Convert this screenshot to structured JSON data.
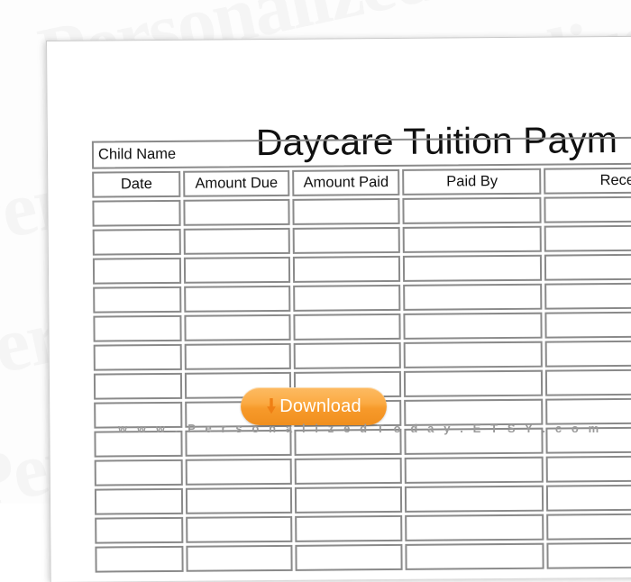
{
  "document": {
    "title": "Daycare Tuition Paym",
    "title_full_visible": "Daycare Tuition Paym",
    "name_field": {
      "label": "Child Name",
      "value": ""
    },
    "table": {
      "columns": [
        "Date",
        "Amount Due",
        "Amount Paid",
        "Paid By",
        "Received"
      ],
      "rows": [
        [
          "",
          "",
          "",
          "",
          ""
        ],
        [
          "",
          "",
          "",
          "",
          ""
        ],
        [
          "",
          "",
          "",
          "",
          ""
        ],
        [
          "",
          "",
          "",
          "",
          ""
        ],
        [
          "",
          "",
          "",
          "",
          ""
        ],
        [
          "",
          "",
          "",
          "",
          ""
        ],
        [
          "",
          "",
          "",
          "",
          ""
        ],
        [
          "",
          "",
          "",
          "",
          ""
        ],
        [
          "",
          "",
          "",
          "",
          ""
        ],
        [
          "",
          "",
          "",
          "",
          ""
        ],
        [
          "",
          "",
          "",
          "",
          ""
        ],
        [
          "",
          "",
          "",
          "",
          ""
        ],
        [
          "",
          "",
          "",
          "",
          ""
        ]
      ]
    }
  },
  "overlay": {
    "download_button": {
      "label": "Download",
      "icon": "download-arrow-icon",
      "color_top": "#fdbb63",
      "color_bottom": "#f08f1e",
      "text_color": "#ffffff"
    },
    "site_watermark": "w w w . P e r s o n a l i z e d T o d a y . E T S Y . c o m"
  },
  "background": {
    "watermark_word": "Personalized",
    "watermark_color": "#7a7a7a",
    "paper_color": "#ffffff",
    "border_color": "#8a8a8a"
  }
}
